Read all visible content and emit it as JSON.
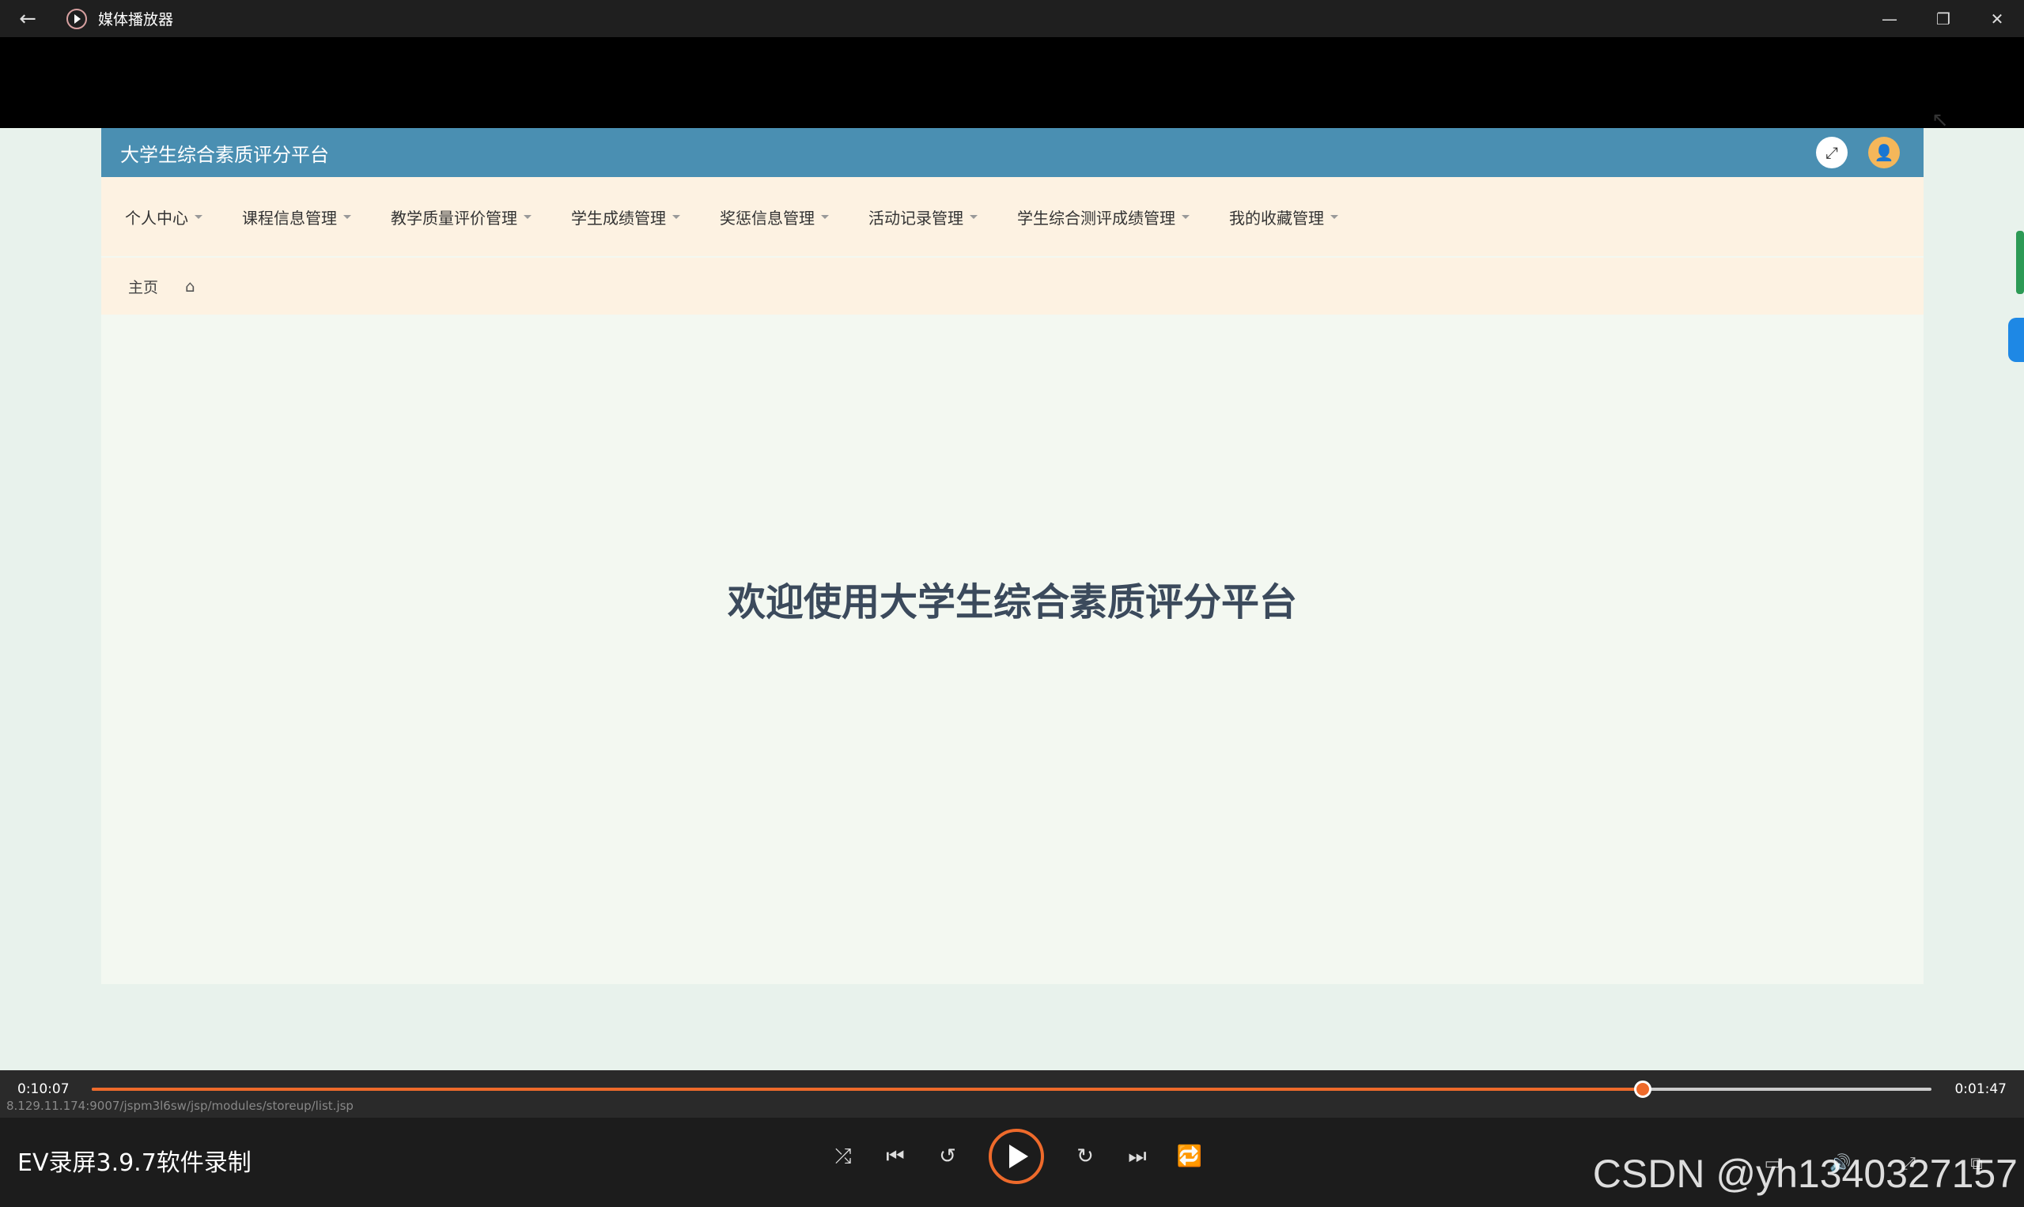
{
  "window": {
    "title": "媒体播放器",
    "minimize": "—",
    "restore": "❐",
    "close": "✕",
    "back": "←"
  },
  "site": {
    "title": "大学生综合素质评分平台",
    "nav": [
      "个人中心",
      "课程信息管理",
      "教学质量评价管理",
      "学生成绩管理",
      "奖惩信息管理",
      "活动记录管理",
      "学生综合测评成绩管理",
      "我的收藏管理"
    ],
    "breadcrumb": "主页",
    "home_icon": "⌂",
    "welcome": "欢迎使用大学生综合素质评分平台",
    "expand_icon": "⤢",
    "user_icon": "👤"
  },
  "player": {
    "current_time": "0:10:07",
    "total_time": "0:01:47",
    "progress": 0.843,
    "status_url": "8.129.11.174:9007/jspm3l6sw/jsp/modules/storeup/list.jsp",
    "recording_label": "EV录屏3.9.7软件录制",
    "watermark": "CSDN @yh1340327157",
    "icons": {
      "shuffle": "⤮",
      "previous": "⏮",
      "rewind10": "↺",
      "forward30": "↻",
      "next": "⏭",
      "repeat": "🔁",
      "subtitles": "▭",
      "volume": "🔊",
      "fullscreen": "⤢",
      "miniplayer": "⧉"
    }
  }
}
